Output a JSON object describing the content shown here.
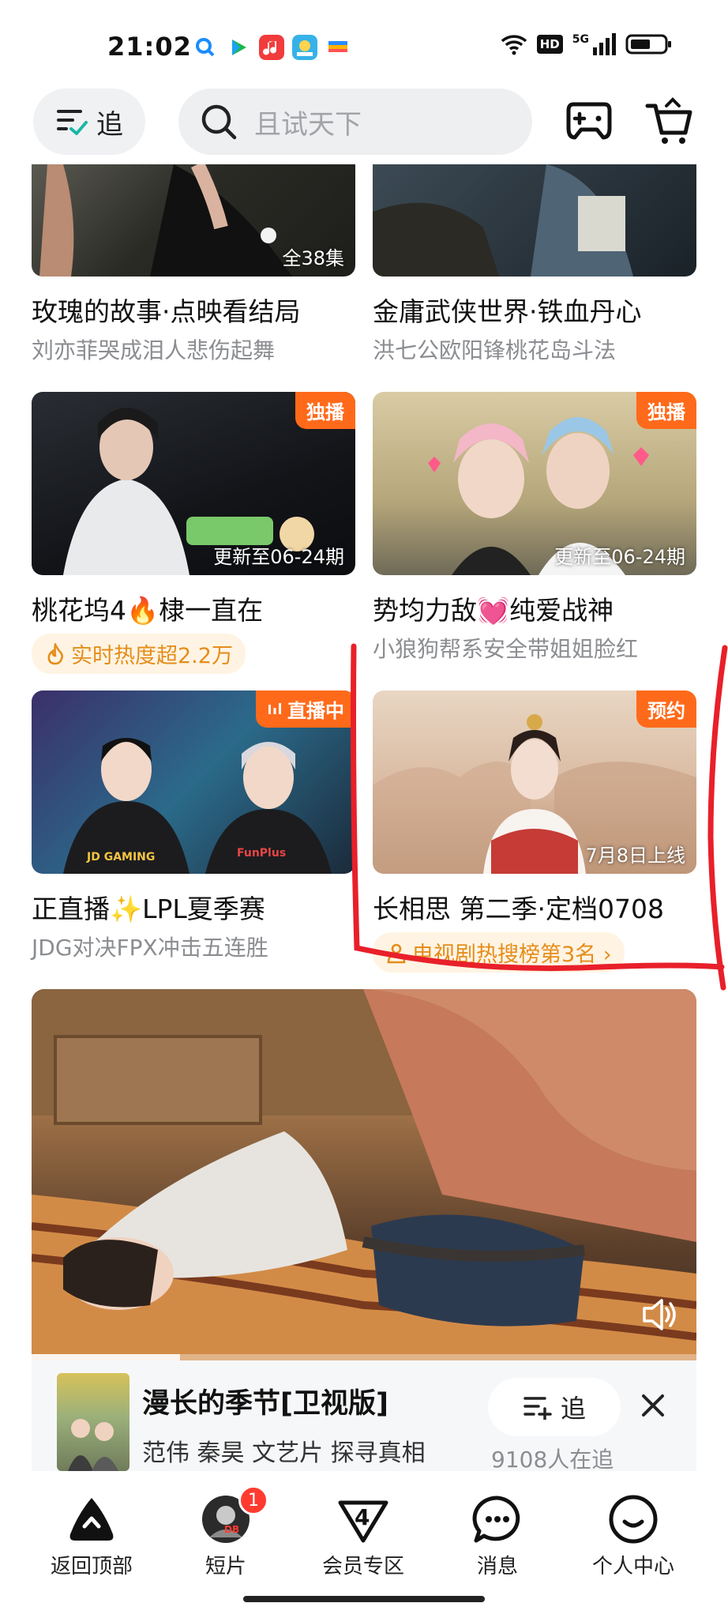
{
  "status_bar": {
    "time": "21:02",
    "hd": "HD",
    "network": "5G"
  },
  "header": {
    "follow_label": "追",
    "search_placeholder": "且试天下"
  },
  "cards": [
    {
      "title": "玫瑰的故事·点映看结局",
      "subtitle": "刘亦菲哭成泪人悲伤起舞",
      "overlay": "全38集",
      "badge": ""
    },
    {
      "title": "金庸武侠世界·铁血丹心",
      "subtitle": "洪七公欧阳锋桃花岛斗法",
      "overlay": "",
      "badge": ""
    },
    {
      "title": "桃花坞4🔥棣一直在",
      "hot": "实时热度超2.2万",
      "overlay": "更新至06-24期",
      "badge": "独播"
    },
    {
      "title": "势均力敌💓纯爱战神",
      "subtitle": "小狼狗帮系安全带姐姐脸红",
      "overlay": "更新至06-24期",
      "badge": "独播"
    },
    {
      "title": "正直播✨LPL夏季赛",
      "subtitle": "JDG对决FPX冲击五连胜",
      "overlay": "",
      "badge": "直播中"
    },
    {
      "title": "长相思 第二季·定档0708",
      "hot": "电视剧热搜榜第3名 ›",
      "overlay": "7月8日上线",
      "badge": "预约"
    }
  ],
  "mini_player": {
    "title": "漫长的季节[卫视版]",
    "tags": "范伟  秦昊  文艺片  探寻真相",
    "follow_label": "追",
    "count": "9108人在追"
  },
  "bottom_nav": [
    {
      "label": "返回顶部",
      "icon": "back-to-top-icon"
    },
    {
      "label": "短片",
      "icon": "shorts-avatar-icon",
      "badge": "1"
    },
    {
      "label": "会员专区",
      "icon": "vip-icon"
    },
    {
      "label": "消息",
      "icon": "message-icon"
    },
    {
      "label": "个人中心",
      "icon": "profile-icon"
    }
  ],
  "colors": {
    "badge": "#ff6a1a",
    "hot_bg": "#fff4e3",
    "hot_text": "#e58d1b",
    "annotation": "#e8202a"
  }
}
